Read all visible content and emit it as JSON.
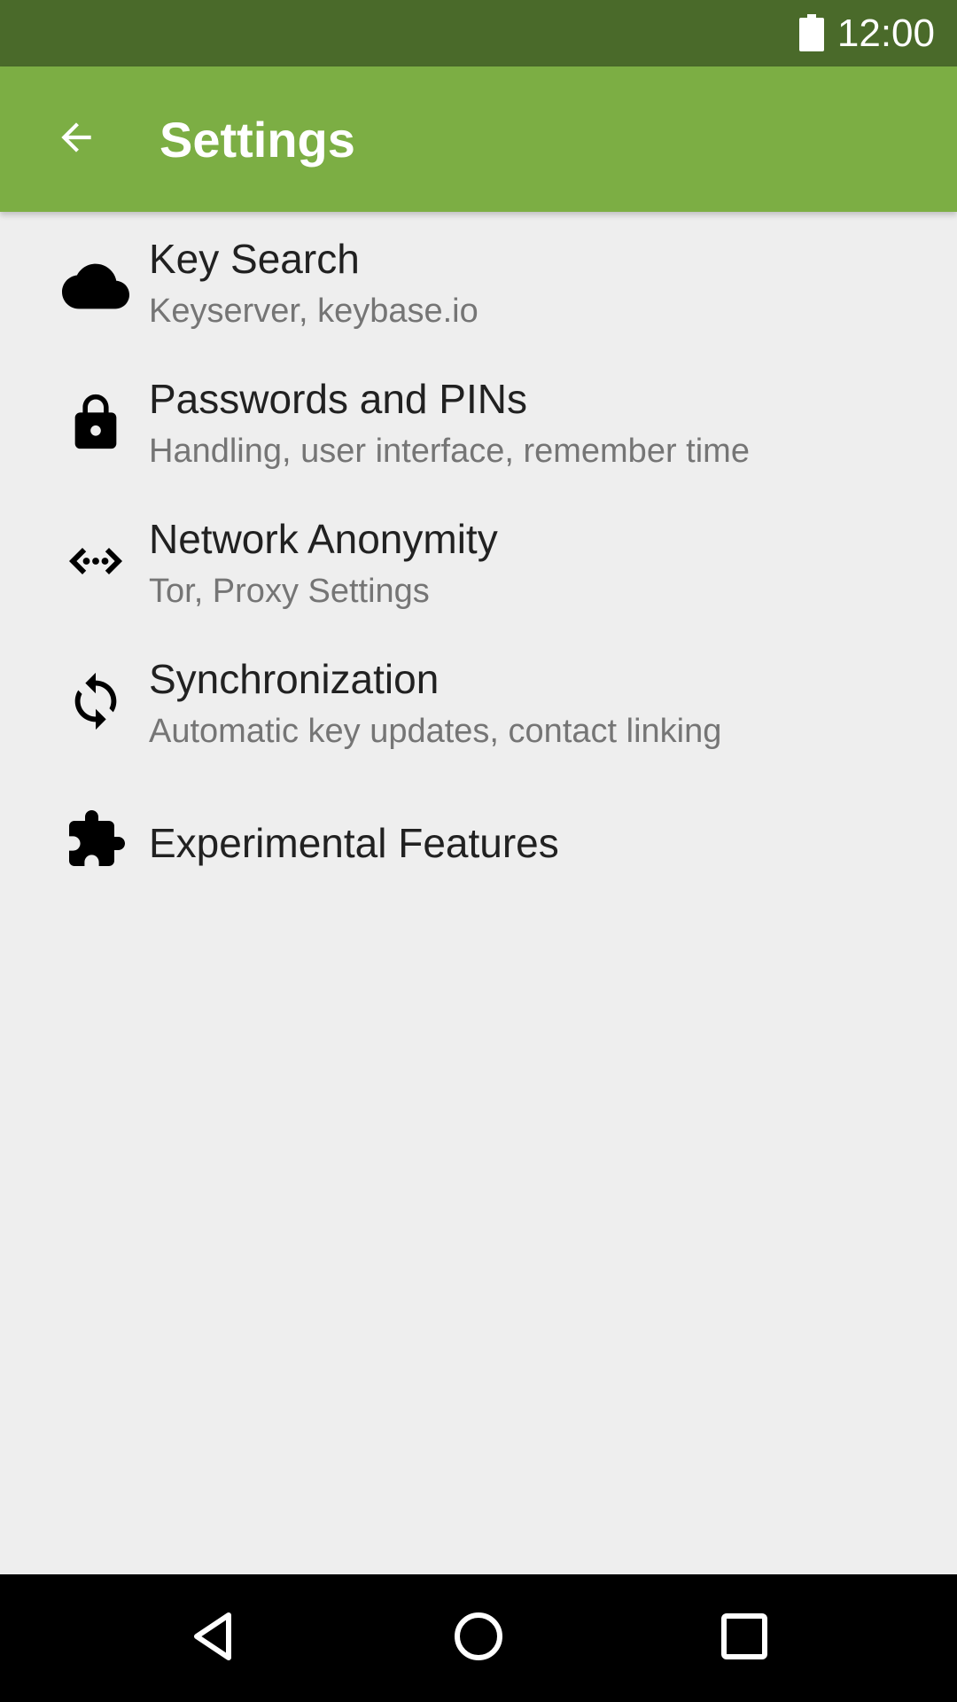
{
  "status_bar": {
    "time": "12:00",
    "battery_icon": "battery-full-icon"
  },
  "app_bar": {
    "title": "Settings",
    "back_icon": "arrow-back-icon",
    "color": "#7cae44",
    "status_color": "#4a6a2a"
  },
  "settings": {
    "items": [
      {
        "icon": "cloud-icon",
        "label": "Key Search",
        "subtitle": "Keyserver, keybase.io"
      },
      {
        "icon": "lock-icon",
        "label": "Passwords and PINs",
        "subtitle": "Handling, user interface, remember time"
      },
      {
        "icon": "network-icon",
        "label": "Network Anonymity",
        "subtitle": "Tor, Proxy Settings"
      },
      {
        "icon": "sync-icon",
        "label": "Synchronization",
        "subtitle": "Automatic key updates, contact linking"
      },
      {
        "icon": "extension-puzzle-icon",
        "label": "Experimental Features"
      }
    ]
  },
  "nav_bar": {
    "back": "nav-back-icon",
    "home": "nav-home-icon",
    "recents": "nav-recents-icon"
  }
}
